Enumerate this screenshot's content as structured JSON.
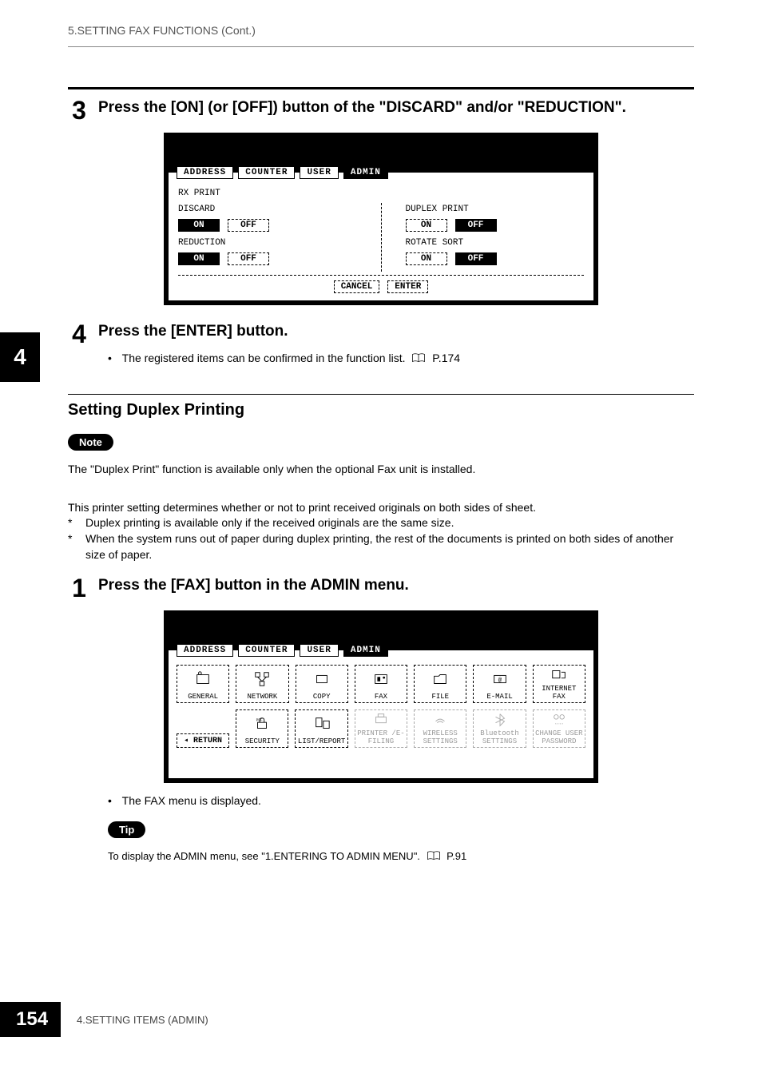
{
  "header": {
    "title": "5.SETTING FAX FUNCTIONS (Cont.)"
  },
  "sidebar": {
    "chapter": "4"
  },
  "step3": {
    "num": "3",
    "text": "Press the [ON] (or [OFF]) button of the \"DISCARD\" and/or \"REDUCTION\"."
  },
  "screenshot1": {
    "tabs": [
      "ADDRESS",
      "COUNTER",
      "USER",
      "ADMIN"
    ],
    "title": "RX PRINT",
    "left": {
      "discard": {
        "label": "DISCARD",
        "on": "ON",
        "off": "OFF"
      },
      "reduction": {
        "label": "REDUCTION",
        "on": "ON",
        "off": "OFF"
      }
    },
    "right": {
      "duplex": {
        "label": "DUPLEX PRINT",
        "on": "ON",
        "off": "OFF"
      },
      "rotate": {
        "label": "ROTATE SORT",
        "on": "ON",
        "off": "OFF"
      }
    },
    "cancel": "CANCEL",
    "enter": "ENTER"
  },
  "step4": {
    "num": "4",
    "text": "Press the [ENTER] button.",
    "bullet": "The registered items can be confirmed in the function list.",
    "ref": "P.174"
  },
  "section": {
    "heading": "Setting Duplex Printing",
    "note_label": "Note",
    "note_text": "The \"Duplex Print\" function is available only when the optional Fax unit is installed.",
    "intro": "This printer setting determines whether or not to print received originals on both sides of sheet.",
    "star1": "Duplex printing is available only if the received originals are the same size.",
    "star2": "When the system runs out of paper during duplex printing, the rest of the documents is printed on both sides of another size of paper."
  },
  "step1b": {
    "num": "1",
    "text": "Press the [FAX] button in the ADMIN menu.",
    "bullet": "The FAX menu is displayed.",
    "tip_label": "Tip",
    "tip_text": "To display the ADMIN menu, see \"1.ENTERING TO ADMIN MENU\".",
    "tip_ref": "P.91"
  },
  "screenshot2": {
    "tabs": [
      "ADDRESS",
      "COUNTER",
      "USER",
      "ADMIN"
    ],
    "row1": [
      "GENERAL",
      "NETWORK",
      "COPY",
      "FAX",
      "FILE",
      "E-MAIL",
      "INTERNET FAX"
    ],
    "row2_return": "RETURN",
    "row2": [
      "SECURITY",
      "LIST/REPORT",
      "PRINTER /E-FILING",
      "WIRELESS SETTINGS",
      "Bluetooth SETTINGS",
      "CHANGE USER PASSWORD"
    ]
  },
  "footer": {
    "page": "154",
    "text": "4.SETTING ITEMS (ADMIN)"
  }
}
